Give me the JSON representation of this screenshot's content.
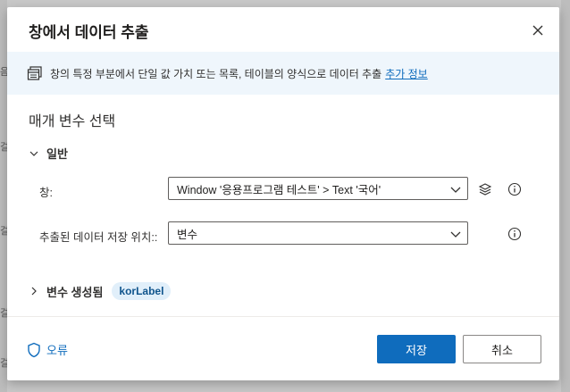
{
  "background": {
    "left_edge_chars": [
      "음",
      "걸",
      "걸",
      "걸",
      "걸"
    ]
  },
  "dialog": {
    "title": "창에서 데이터 추출",
    "info": {
      "text": "창의 특정 부분에서 단일 값 가치 또는 목록, 테이블의 양식으로 데이터 추출",
      "link": "추가 정보"
    },
    "section_title": "매개 변수 선택",
    "general_group": {
      "label": "일반",
      "window_label": "창:",
      "window_value": "Window '응용프로그램 테스트' > Text '국어'",
      "store_label": "추출된 데이터 저장 위치::",
      "store_value": "변수"
    },
    "variables": {
      "label": "변수 생성됨",
      "chip": "korLabel"
    },
    "footer": {
      "error_label": "오류",
      "save_label": "저장",
      "cancel_label": "취소"
    }
  },
  "colors": {
    "primary": "#0f6cbd",
    "info_bg": "#eff6fc",
    "chip_bg": "#e1effa"
  }
}
